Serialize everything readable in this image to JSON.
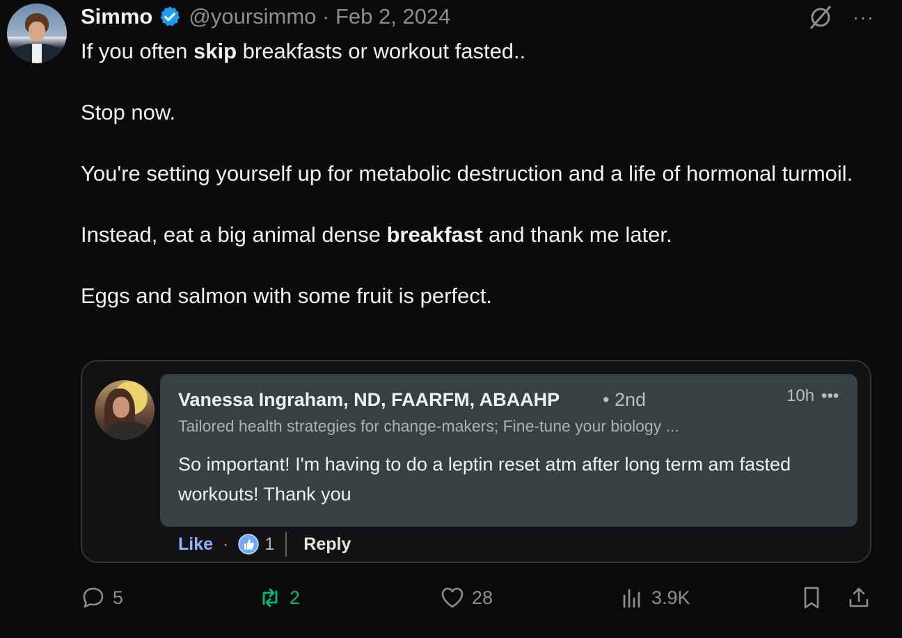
{
  "tweet": {
    "author_name": "Simmo",
    "handle_date": "@yoursimmo · Feb 2, 2024",
    "more_label": "···",
    "lines": {
      "l1a": "If you often ",
      "l1b": "skip",
      "l1c": " breakfasts or workout fasted..",
      "l2": "Stop now.",
      "l3": "You're setting yourself up for metabolic destruction and a life of hormonal turmoil.",
      "l4a": "Instead, eat a big animal dense ",
      "l4b": "breakfast",
      "l4c": " and thank me later.",
      "l5": "Eggs and salmon with some fruit is perfect."
    }
  },
  "quote": {
    "name": "Vanessa Ingraham, ND, FAARFM, ABAAHP",
    "degree": "• 2nd",
    "time": "10h",
    "more": "•••",
    "headline": "Tailored health strategies for change-makers; Fine-tune your biology ...",
    "text": "So important! I'm having to do a leptin reset atm after long term am fasted workouts! Thank you",
    "like_label": "Like",
    "dot": "·",
    "reaction_count": "1",
    "reply_label": "Reply"
  },
  "actions": {
    "replies": "5",
    "reposts": "2",
    "likes": "28",
    "views": "3.9K"
  },
  "colors": {
    "background": "#0a0a0a",
    "verified": "#1d9bf0",
    "repost": "#00ba7c",
    "like_blue": "#8fb4ff"
  }
}
